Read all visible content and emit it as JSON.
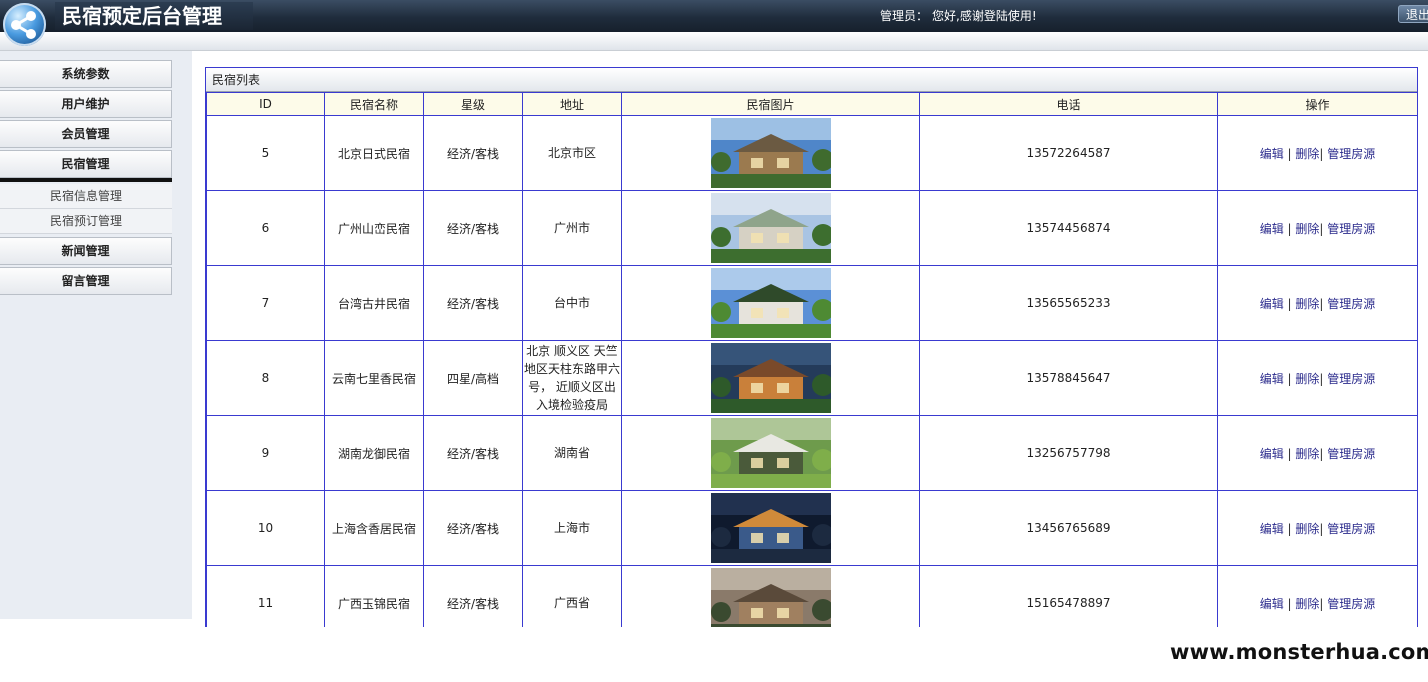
{
  "header": {
    "title": "民宿预定后台管理",
    "admin_label": "管理员：",
    "welcome": "您好,感谢登陆使用!",
    "logout_label": "退出",
    "logo_icon": "share-network-icon"
  },
  "sidebar": {
    "items": [
      {
        "label": "系统参数"
      },
      {
        "label": "用户维护"
      },
      {
        "label": "会员管理"
      },
      {
        "label": "民宿管理"
      },
      {
        "label": "新闻管理"
      },
      {
        "label": "留言管理"
      }
    ],
    "active": "民宿管理",
    "submenu": [
      {
        "label": "民宿信息管理"
      },
      {
        "label": "民宿预订管理"
      }
    ]
  },
  "panel": {
    "title": "民宿列表",
    "columns": [
      "ID",
      "民宿名称",
      "星级",
      "地址",
      "民宿图片",
      "电话",
      "操作"
    ],
    "actions": {
      "edit": "编辑",
      "delete": "删除",
      "rooms": "管理房源",
      "sep1": "|",
      "sep2": "|"
    },
    "rows": [
      {
        "id": "5",
        "name": "北京日式民宿",
        "star": "经济/客栈",
        "address": "北京市区",
        "phone": "13572264587"
      },
      {
        "id": "6",
        "name": "广州山峦民宿",
        "star": "经济/客栈",
        "address": "广州市",
        "phone": "13574456874"
      },
      {
        "id": "7",
        "name": "台湾古井民宿",
        "star": "经济/客栈",
        "address": "台中市",
        "phone": "13565565233"
      },
      {
        "id": "8",
        "name": "云南七里香民宿",
        "star": "四星/高档",
        "address": "北京 顺义区 天竺地区天柱东路甲六号， 近顺义区出入境检验疫局",
        "phone": "13578845647"
      },
      {
        "id": "9",
        "name": "湖南龙御民宿",
        "star": "经济/客栈",
        "address": "湖南省",
        "phone": "13256757798"
      },
      {
        "id": "10",
        "name": "上海含香居民宿",
        "star": "经济/客栈",
        "address": "上海市",
        "phone": "13456765689"
      },
      {
        "id": "11",
        "name": "广西玉锦民宿",
        "star": "经济/客栈",
        "address": "广西省",
        "phone": "15165478897"
      }
    ]
  },
  "watermark": "www.monsterhua.com",
  "colors": {
    "grid": "#3a3ad0",
    "header_dark": "#1f2c3c",
    "link": "#2b2b8c"
  }
}
